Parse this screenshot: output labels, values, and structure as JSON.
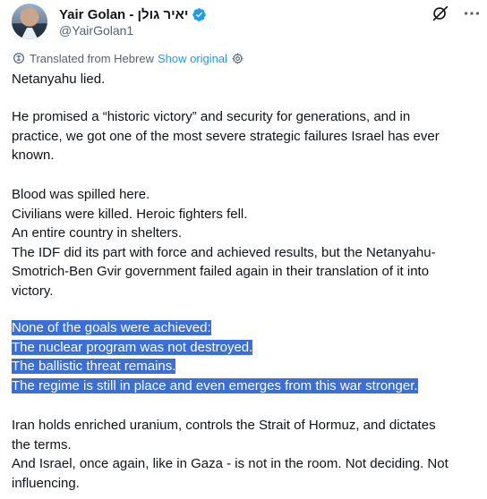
{
  "author": {
    "display_name": "Yair Golan - יאיר גולן",
    "handle": "@YairGolan1"
  },
  "translation": {
    "label": "Translated from Hebrew",
    "show_original": "Show original"
  },
  "icons": {
    "verified": "verified-badge-icon",
    "grok": "grok-icon",
    "more": "more-icon",
    "translate": "translate-icon",
    "settings": "gear-icon"
  },
  "colors": {
    "verified": "#1d9bf0",
    "link": "#1d9bf0",
    "selection": "#3b6fd6"
  },
  "tweet": {
    "p1": [
      "Netanyahu lied."
    ],
    "p2": [
      "He promised a “historic victory” and security for generations, and in",
      "practice, we got one of the most severe strategic failures Israel has ever",
      "known."
    ],
    "p3": [
      "Blood was spilled here.",
      "Civilians were killed. Heroic fighters fell.",
      "An entire country in shelters.",
      "The IDF did its part with force and achieved results, but the Netanyahu-",
      "Smotrich-Ben Gvir government failed again in their translation of it into",
      "victory."
    ],
    "p4": [
      "None of the goals were achieved:",
      "The nuclear program was not destroyed.",
      "The ballistic threat remains.",
      "The regime is still in place and even emerges from this war stronger."
    ],
    "p5": [
      "Iran holds enriched uranium, controls the Strait of Hormuz, and dictates",
      "the terms.",
      "And Israel, once again, like in Gaza - is not in the room. Not deciding. Not",
      "influencing."
    ]
  }
}
